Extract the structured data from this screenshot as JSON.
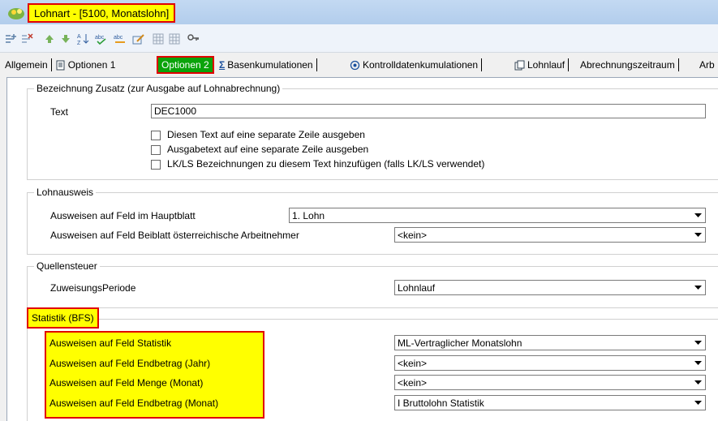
{
  "window": {
    "title": "Lohnart - [5100, Monatslohn]"
  },
  "toolbar": {
    "icons": [
      "insert-row-icon",
      "delete-row-icon",
      "move-up-icon",
      "move-down-icon",
      "sort-icon",
      "spellcheck-icon",
      "spellcheck2-icon",
      "edit-icon",
      "grid-icon",
      "grid2-icon",
      "key-icon"
    ]
  },
  "tabs": {
    "allgemein": "Allgemein",
    "optionen1": "Optionen 1",
    "optionen2": "Optionen 2",
    "basenkumulationen": "Basenkumulationen",
    "kontrolldaten": "Kontrolldatenkumulationen",
    "lohnlauf": "Lohnlauf",
    "abrechnungszeitraum": "Abrechnungszeitraum",
    "arb": "Arb"
  },
  "bezeichnung": {
    "legend": "Bezeichnung Zusatz (zur Ausgabe auf Lohnabrechnung)",
    "text_label": "Text",
    "text_value": "DEC1000",
    "cb1": "Diesen Text auf eine separate Zeile ausgeben",
    "cb2": "Ausgabetext auf eine separate Zeile ausgeben",
    "cb3": "LK/LS Bezeichnungen zu diesem Text hinzufügen (falls LK/LS verwendet)"
  },
  "lohnausweis": {
    "legend": "Lohnausweis",
    "hauptblatt_label": "Ausweisen auf Feld im Hauptblatt",
    "hauptblatt_value": "1. Lohn",
    "beiblatt_label": "Ausweisen auf Feld Beiblatt österreichische Arbeitnehmer",
    "beiblatt_value": "<kein>"
  },
  "quellensteuer": {
    "legend": "Quellensteuer",
    "periode_label": "ZuweisungsPeriode",
    "periode_value": "Lohnlauf"
  },
  "statistik": {
    "legend": "Statistik (BFS)",
    "rows": [
      {
        "label": "Ausweisen auf Feld Statistik",
        "value": "ML-Vertraglicher Monatslohn"
      },
      {
        "label": "Ausweisen auf Feld Endbetrag (Jahr)",
        "value": "<kein>"
      },
      {
        "label": "Ausweisen auf Feld Menge (Monat)",
        "value": "<kein>"
      },
      {
        "label": "Ausweisen auf Feld Endbetrag (Monat)",
        "value": "I Bruttolohn Statistik"
      }
    ]
  },
  "colors": {
    "highlight": "#ffff00",
    "highlight_border": "#e00000",
    "active_tab": "#0aa30a"
  }
}
